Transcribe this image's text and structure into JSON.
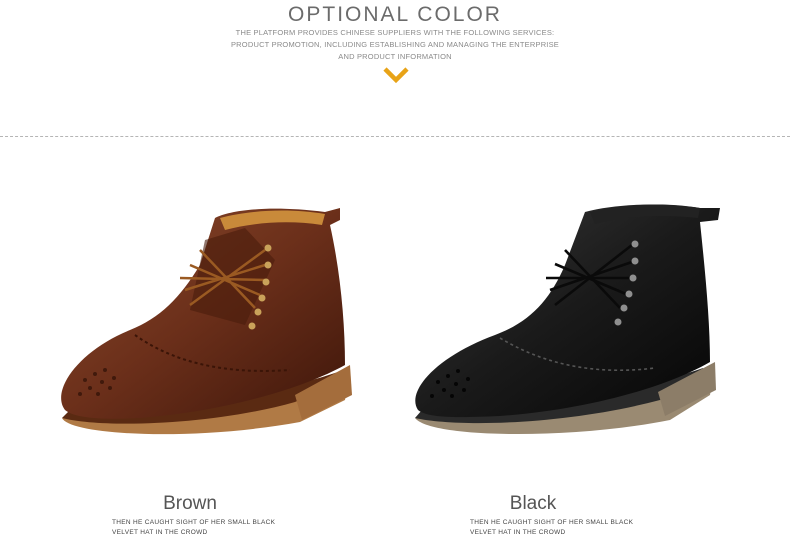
{
  "header": {
    "title": "OPTIONAL COLOR",
    "desc_line1": "THE PLATFORM PROVIDES CHINESE SUPPLIERS WITH THE FOLLOWING SERVICES:",
    "desc_line2": "PRODUCT PROMOTION, INCLUDING ESTABLISHING AND MANAGING THE ENTERPRISE",
    "desc_line3": "AND PRODUCT INFORMATION",
    "accent_color": "#e8a317",
    "chevron_icon": "chevron-down-icon"
  },
  "products": [
    {
      "name": "Brown",
      "desc_line1": "THEN HE CAUGHT SIGHT OF HER SMALL BLACK",
      "desc_line2": "VELVET HAT IN THE CROWD",
      "color": "#6b2f1a"
    },
    {
      "name": "Black",
      "desc_line1": "THEN HE CAUGHT SIGHT OF HER SMALL BLACK",
      "desc_line2": "VELVET HAT IN THE CROWD",
      "color": "#1a1a1a"
    }
  ]
}
